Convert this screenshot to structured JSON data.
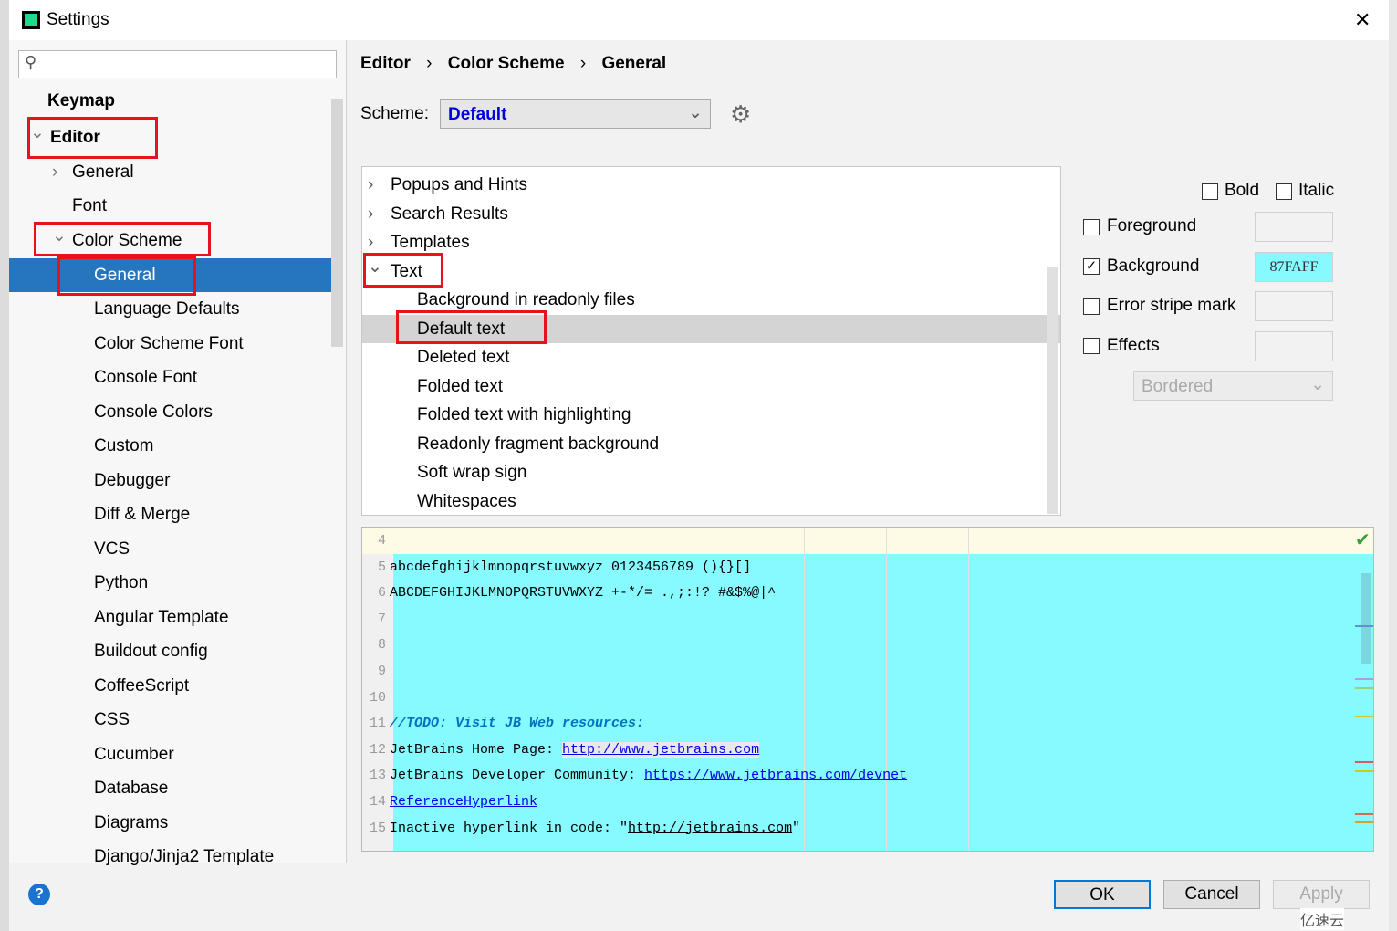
{
  "window": {
    "title": "Settings",
    "close": "✕"
  },
  "search": {
    "placeholder": ""
  },
  "sidebar": {
    "items": [
      {
        "label": "Keymap",
        "bold": true
      },
      {
        "label": "Editor",
        "bold": true,
        "expanded": true
      },
      {
        "label": "General"
      },
      {
        "label": "Font"
      },
      {
        "label": "Color Scheme",
        "expanded": true
      },
      {
        "label": "General",
        "selected": true
      },
      {
        "label": "Language Defaults"
      },
      {
        "label": "Color Scheme Font"
      },
      {
        "label": "Console Font"
      },
      {
        "label": "Console Colors"
      },
      {
        "label": "Custom"
      },
      {
        "label": "Debugger"
      },
      {
        "label": "Diff & Merge"
      },
      {
        "label": "VCS"
      },
      {
        "label": "Python"
      },
      {
        "label": "Angular Template"
      },
      {
        "label": "Buildout config"
      },
      {
        "label": "CoffeeScript"
      },
      {
        "label": "CSS"
      },
      {
        "label": "Cucumber"
      },
      {
        "label": "Database"
      },
      {
        "label": "Diagrams"
      },
      {
        "label": "Django/Jinja2 Template"
      }
    ]
  },
  "breadcrumb": [
    "Editor",
    "Color Scheme",
    "General"
  ],
  "scheme": {
    "label": "Scheme:",
    "value": "Default"
  },
  "tree": [
    {
      "label": "Popups and Hints",
      "arrow": "›"
    },
    {
      "label": "Search Results",
      "arrow": "›"
    },
    {
      "label": "Templates",
      "arrow": "›"
    },
    {
      "label": "Text",
      "arrow": "⌄"
    },
    {
      "label": "Background in readonly files"
    },
    {
      "label": "Default text",
      "selected": true
    },
    {
      "label": "Deleted text"
    },
    {
      "label": "Folded text"
    },
    {
      "label": "Folded text with highlighting"
    },
    {
      "label": "Readonly fragment background"
    },
    {
      "label": "Soft wrap sign"
    },
    {
      "label": "Whitespaces"
    }
  ],
  "attributes": {
    "bold": "Bold",
    "italic": "Italic",
    "foreground": "Foreground",
    "background": "Background",
    "background_value": "87FAFF",
    "background_checked": true,
    "error_stripe": "Error stripe mark",
    "effects": "Effects",
    "effects_type": "Bordered"
  },
  "preview": {
    "lines": [
      {
        "n": "4",
        "text": ""
      },
      {
        "n": "5",
        "text": "abcdefghijklmnopqrstuvwxyz 0123456789 (){}[]"
      },
      {
        "n": "6",
        "text": "ABCDEFGHIJKLMNOPQRSTUVWXYZ +-*/= .,;:!? #&$%@|^"
      },
      {
        "n": "7",
        "text": ""
      },
      {
        "n": "8",
        "text": ""
      },
      {
        "n": "9",
        "text": ""
      },
      {
        "n": "10",
        "text": ""
      },
      {
        "n": "11",
        "text": "//TODO: Visit JB Web resources:"
      },
      {
        "n": "12",
        "text": "JetBrains Home Page: ",
        "link": "http://www.jetbrains.com"
      },
      {
        "n": "13",
        "text": "JetBrains Developer Community: ",
        "link": "https://www.jetbrains.com/devnet"
      },
      {
        "n": "14",
        "text": "",
        "link": "ReferenceHyperlink"
      },
      {
        "n": "15",
        "text": "Inactive hyperlink in code: \"",
        "link": "http://jetbrains.com",
        "after": "\""
      }
    ]
  },
  "buttons": {
    "ok": "OK",
    "cancel": "Cancel",
    "apply": "Apply",
    "help": "?"
  },
  "colors": {
    "accent": "#2675bf",
    "preview_bg": "#87FAFF",
    "annotation": "#e8121a"
  },
  "watermark": "亿速云"
}
